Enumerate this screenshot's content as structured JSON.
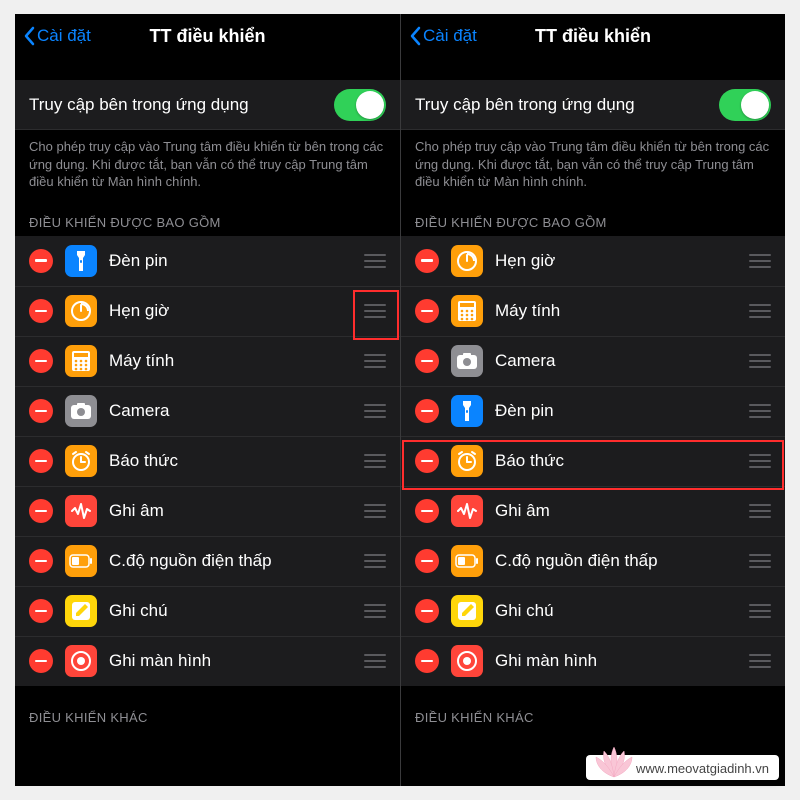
{
  "nav": {
    "back": "Cài đặt",
    "title": "TT điều khiển"
  },
  "access": {
    "label": "Truy cập bên trong ứng dụng",
    "footer": "Cho phép truy cập vào Trung tâm điều khiển từ bên trong các ứng dụng. Khi được tắt, bạn vẫn có thể truy cập Trung tâm điều khiển từ Màn hình chính."
  },
  "sections": {
    "included": "ĐIỀU KHIỂN ĐƯỢC BAO GỒM",
    "other": "ĐIỀU KHIỂN KHÁC"
  },
  "left_items": [
    {
      "title": "Đèn pin",
      "icon": "flashlight",
      "bg": "bg-blue"
    },
    {
      "title": "Hẹn giờ",
      "icon": "timer",
      "bg": "bg-orange"
    },
    {
      "title": "Máy tính",
      "icon": "calculator",
      "bg": "bg-orange"
    },
    {
      "title": "Camera",
      "icon": "camera",
      "bg": "bg-gray"
    },
    {
      "title": "Báo thức",
      "icon": "alarm",
      "bg": "bg-orange"
    },
    {
      "title": "Ghi âm",
      "icon": "voice",
      "bg": "bg-red"
    },
    {
      "title": "C.độ nguồn điện thấp",
      "icon": "battery",
      "bg": "bg-orange"
    },
    {
      "title": "Ghi chú",
      "icon": "notes",
      "bg": "bg-yellow"
    },
    {
      "title": "Ghi màn hình",
      "icon": "record",
      "bg": "bg-red"
    }
  ],
  "right_items": [
    {
      "title": "Hẹn giờ",
      "icon": "timer",
      "bg": "bg-orange"
    },
    {
      "title": "Máy tính",
      "icon": "calculator",
      "bg": "bg-orange"
    },
    {
      "title": "Camera",
      "icon": "camera",
      "bg": "bg-gray"
    },
    {
      "title": "Đèn pin",
      "icon": "flashlight",
      "bg": "bg-blue"
    },
    {
      "title": "Báo thức",
      "icon": "alarm",
      "bg": "bg-orange"
    },
    {
      "title": "Ghi âm",
      "icon": "voice",
      "bg": "bg-red"
    },
    {
      "title": "C.độ nguồn điện thấp",
      "icon": "battery",
      "bg": "bg-orange"
    },
    {
      "title": "Ghi chú",
      "icon": "notes",
      "bg": "bg-yellow"
    },
    {
      "title": "Ghi màn hình",
      "icon": "record",
      "bg": "bg-red"
    }
  ],
  "watermark": "www.meovatgiadinh.vn"
}
